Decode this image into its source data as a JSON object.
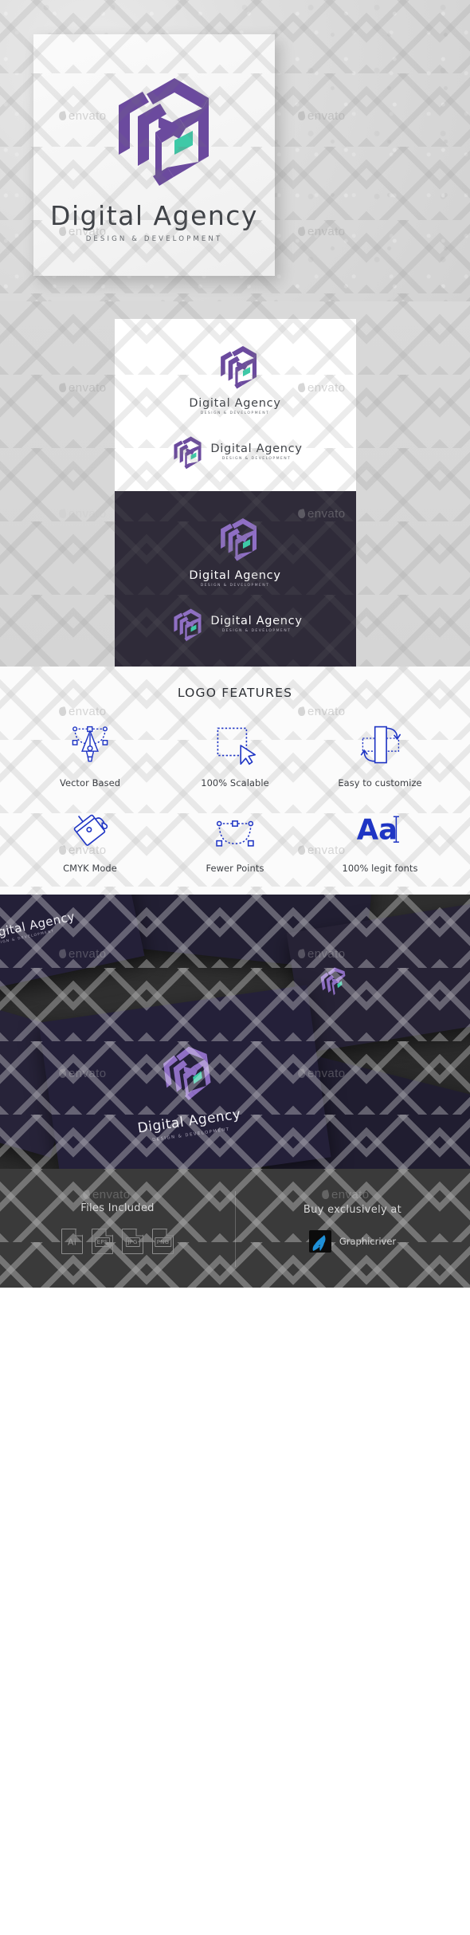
{
  "brand": {
    "name": "Digital Agency",
    "tagline": "DESIGN & DEVELOPMENT",
    "colors": {
      "purple_dark": "#6b4a9e",
      "purple_light": "#8f6fc4",
      "teal": "#3ec9a7",
      "dark_panel": "#2f2b39",
      "card_navy": "#242038",
      "icon_blue": "#1f35c4",
      "text_dark": "#3f4247"
    }
  },
  "watermark": {
    "label": "envato"
  },
  "hero": {
    "title": "Digital Agency",
    "tagline": "DESIGN & DEVELOPMENT",
    "mark_name": "digital-agency-hexagon-mark"
  },
  "variants": {
    "light": {
      "background": "#ffffff",
      "items": [
        {
          "layout": "stacked",
          "title": "Digital Agency",
          "tagline": "DESIGN & DEVELOPMENT"
        },
        {
          "layout": "horizontal",
          "title": "Digital Agency",
          "tagline": "DESIGN & DEVELOPMENT"
        }
      ]
    },
    "dark": {
      "background": "#2f2b39",
      "items": [
        {
          "layout": "stacked",
          "title": "Digital Agency",
          "tagline": "DESIGN & DEVELOPMENT"
        },
        {
          "layout": "horizontal",
          "title": "Digital Agency",
          "tagline": "DESIGN & DEVELOPMENT"
        }
      ]
    }
  },
  "features": {
    "heading": "LOGO FEATURES",
    "items": [
      {
        "label": "Vector Based",
        "icon": "pen-tool-icon"
      },
      {
        "label": "100% Scalable",
        "icon": "selection-cursor-icon"
      },
      {
        "label": "Easy to customize",
        "icon": "flip-transform-icon"
      },
      {
        "label": "CMYK Mode",
        "icon": "paint-bucket-icon"
      },
      {
        "label": "Fewer Points",
        "icon": "bezier-curve-icon"
      },
      {
        "label": "100% legit fonts",
        "icon": "type-aa-icon"
      }
    ]
  },
  "mockup": {
    "card_title": "Digital Agency",
    "card_tagline": "DESIGN & DEVELOPMENT",
    "secondary_card_title": "Digital Agency",
    "secondary_card_tagline": "DESIGN & DEVELOPMENT"
  },
  "footer": {
    "files_title": "Files Included",
    "files": [
      {
        "label": "Ai",
        "styled": "plain"
      },
      {
        "label": "EPS",
        "styled": "boxed"
      },
      {
        "label": "JPG",
        "styled": "boxed"
      },
      {
        "label": "PNG",
        "styled": "boxed"
      }
    ],
    "buy_title": "Buy exclusively at",
    "marketplace": "Graphicriver"
  }
}
